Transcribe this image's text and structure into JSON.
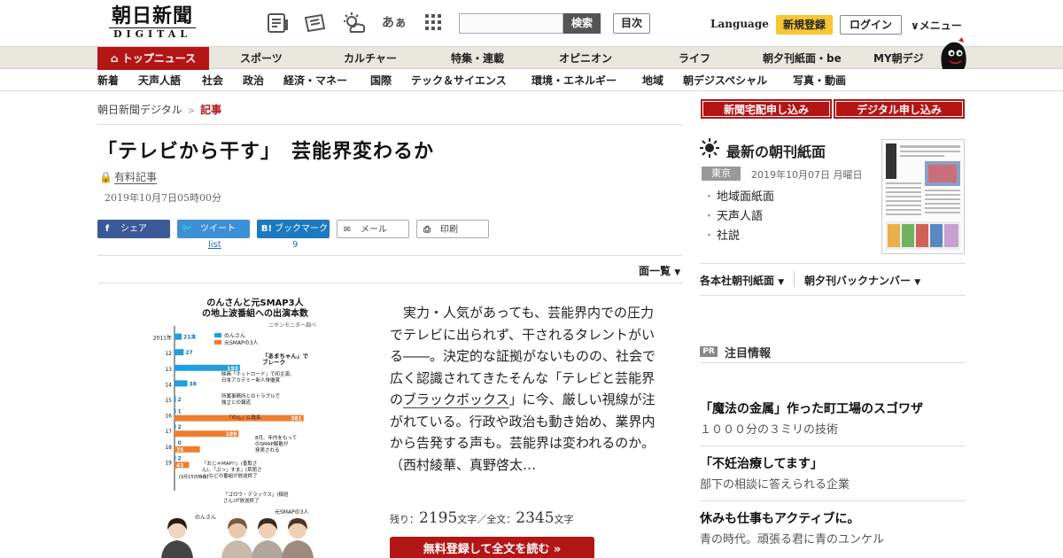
{
  "header": {
    "logo_main": "朝日新聞",
    "logo_sub": "DIGITAL",
    "search_placeholder": "",
    "search_button": "検索",
    "toc_button": "目次",
    "language": "Language",
    "register": "新規登録",
    "login": "ログイン",
    "menu": "メニュー",
    "font_toggle": "あぁ",
    "accent": "#b41515",
    "register_color": "#f8c631"
  },
  "nav_primary": [
    "トップニュース",
    "スポーツ",
    "カルチャー",
    "特集・連載",
    "オピニオン",
    "ライフ",
    "朝夕刊紙面・be",
    "MY朝デジ"
  ],
  "nav_secondary": [
    "新着",
    "天声人語",
    "社会",
    "政治",
    "経済・マネー",
    "国際",
    "テック＆サイエンス",
    "環境・エネルギー",
    "地域",
    "朝デジスペシャル",
    "写真・動画"
  ],
  "breadcrumb": {
    "home": "朝日新聞デジタル",
    "sep": ">",
    "current": "記事"
  },
  "article": {
    "title": "「テレビから干す」　芸能界変わるか",
    "paid_label": "有料記事",
    "date": "2019年10月7日05時00分",
    "share": {
      "facebook": "シェア",
      "twitter": "ツイート",
      "hatena": "ブックマーク",
      "mail": "メール",
      "print": "印刷",
      "twitter_count": "list",
      "hatena_count": "9"
    },
    "page_list": "面一覧",
    "body_pre": "実力・人気があっても、芸能界内での圧力でテレビに出られず、干されるタレントがいる――。決定的な証拠がないものの、社会で広く認識されてきたそんな「テレビと芸能界の",
    "body_link": "ブラックボックス",
    "body_post": "」に今、厳しい視線が注がれている。行政や政治も動き始め、業界内から告発する声も。芸能界は変われるのか。（西村綾華、真野啓太…",
    "remain_label": "残り：",
    "remain_num": "2195",
    "remain_unit": "文字／全文：",
    "total_num": "2345",
    "total_unit": "文字",
    "cta": "無料登録して全文を読む"
  },
  "chart_data": {
    "type": "bar",
    "title": "のんさんと元SMAP3人の地上波番組への出演本数",
    "subtitle": "ニホンモニター調べ",
    "categories": [
      "2011年",
      "12",
      "13",
      "14",
      "15",
      "16",
      "17",
      "18",
      "19"
    ],
    "series": [
      {
        "name": "のんさん",
        "color": "#1fa0dc",
        "values": [
          21,
          27,
          193,
          38,
          2,
          1,
          2,
          0,
          2
        ]
      },
      {
        "name": "元SMAPの3人",
        "color": "#ef7d2e",
        "values": [
          null,
          null,
          null,
          null,
          null,
          381,
          189,
          75,
          43
        ]
      }
    ],
    "value_labels": {
      "のんさん": [
        "21本",
        "27",
        "193",
        "38",
        "2",
        "1",
        "2",
        "0",
        "2"
      ],
      "元SMAPの3人": [
        "",
        "",
        "",
        "",
        "",
        "381",
        "189",
        "75",
        "43"
      ]
    },
    "annotations": [
      "「あまちゃん」で\nブレーク",
      "映画「ホットロード」で初主演、\n日本アカデミー新人俳優賞",
      "所属事務所とのトラブルで\n独立との報道",
      "「のん」に改名",
      "8月、年内をもって\nのSMAP解散が\n発表される",
      "「おじゃMAP!!」(香取さ\nん)、「ぷっ」すま」(草彅さ\nん)などの番組が放送終了",
      "(9月15日時点)",
      "「ゴロウ・デラックス」(稲垣\nさん)が放送終了"
    ],
    "photo_captions": [
      "のんさん",
      "元SMAPの3人"
    ],
    "xlim": [
      0,
      400
    ]
  },
  "sidebar": {
    "btn_delivery": "新聞宅配申し込み",
    "btn_digital": "デジタル申し込み",
    "morning_title": "最新の朝刊紙面",
    "city": "東京",
    "morning_date": "2019年10月07日 月曜日",
    "morning_links": [
      "地域面紙面",
      "天声人語",
      "社説"
    ],
    "dropdown_1": "各本社朝刊紙面",
    "dropdown_2": "朝夕刊バックナンバー",
    "pr_badge": "PR",
    "pr_title": "注目情報",
    "pr_items": [
      {
        "headline": "「魔法の金属」作った町工場のスゴワザ",
        "sub": "１０００分の３ミリの技術"
      },
      {
        "headline": "「不妊治療してます」",
        "sub": "部下の相談に答えられる企業"
      },
      {
        "headline": "休みも仕事もアクティブに。",
        "sub": "青の時代。頑張る君に青のユンケル"
      }
    ]
  }
}
